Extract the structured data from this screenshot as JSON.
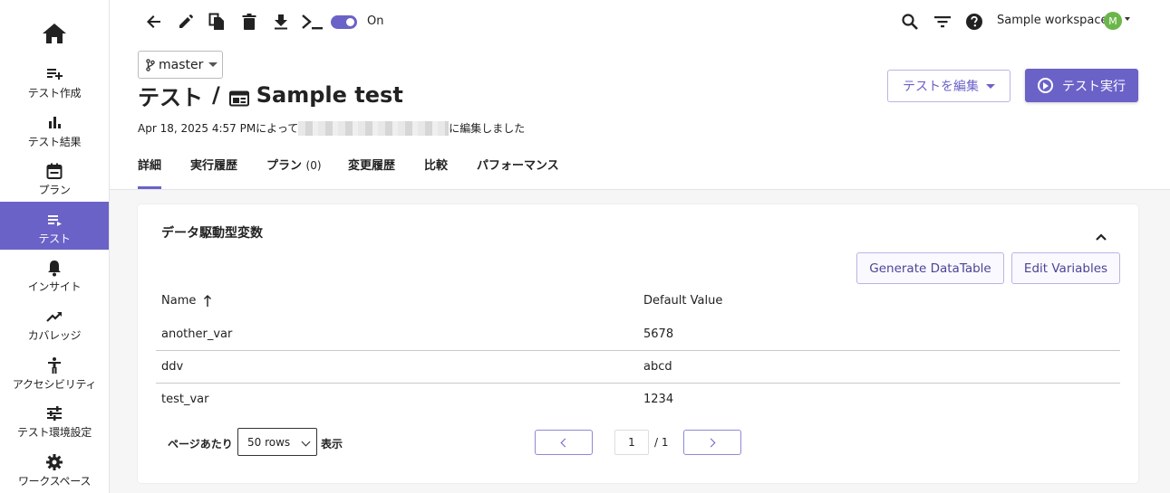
{
  "sidebar": {
    "home_icon": "home-icon",
    "items": [
      {
        "label": "テスト作成",
        "icon": "playlist-add-icon"
      },
      {
        "label": "テスト結果",
        "icon": "bar-chart-icon"
      },
      {
        "label": "プラン",
        "icon": "calendar-icon"
      },
      {
        "label": "テスト",
        "icon": "list-icon",
        "active": true
      },
      {
        "label": "インサイト",
        "icon": "bell-icon"
      },
      {
        "label": "カバレッジ",
        "icon": "trending-up-icon"
      },
      {
        "label": "アクセシビリティ",
        "icon": "accessibility-icon"
      },
      {
        "label": "テスト環境設定",
        "icon": "tune-icon"
      },
      {
        "label": "ワークスペース",
        "icon": "gear-icon"
      }
    ]
  },
  "toolbar": {
    "icons": [
      "back-arrow-icon",
      "edit-icon",
      "copy-icon",
      "delete-icon",
      "download-icon",
      "terminal-icon"
    ],
    "toggle_state": "On",
    "right_icons": [
      "search-icon",
      "filter-icon",
      "help-icon"
    ],
    "workspace_name": "Sample workspace",
    "avatar_initial": "M"
  },
  "branch": {
    "name": "master"
  },
  "title": {
    "prefix": "テスト",
    "separator": "/",
    "name": "Sample test"
  },
  "meta": {
    "date": "Apr 18, 2025 4:57 PMによって",
    "suffix": "に編集しました"
  },
  "actions": {
    "edit_label": "テストを編集",
    "run_label": "テスト実行"
  },
  "tabs": [
    {
      "label": "詳細",
      "active": true
    },
    {
      "label": "実行履歴"
    },
    {
      "label": "プラン",
      "count": "(0)"
    },
    {
      "label": "変更履歴"
    },
    {
      "label": "比較"
    },
    {
      "label": "パフォーマンス"
    }
  ],
  "card": {
    "title": "データ駆動型変数",
    "generate_label": "Generate DataTable",
    "edit_vars_label": "Edit Variables",
    "columns": [
      "Name",
      "Default Value"
    ],
    "rows": [
      {
        "name": "another_var",
        "value": "5678"
      },
      {
        "name": "ddv",
        "value": "abcd"
      },
      {
        "name": "test_var",
        "value": "1234"
      }
    ],
    "pager": {
      "per_page_label": "ページあたり",
      "rows_option": "50 rows",
      "display_label": "表示",
      "current_page": "1",
      "total_pages": "/ 1"
    }
  },
  "colors": {
    "accent": "#6b62c8",
    "avatar": "#6bb64a"
  }
}
